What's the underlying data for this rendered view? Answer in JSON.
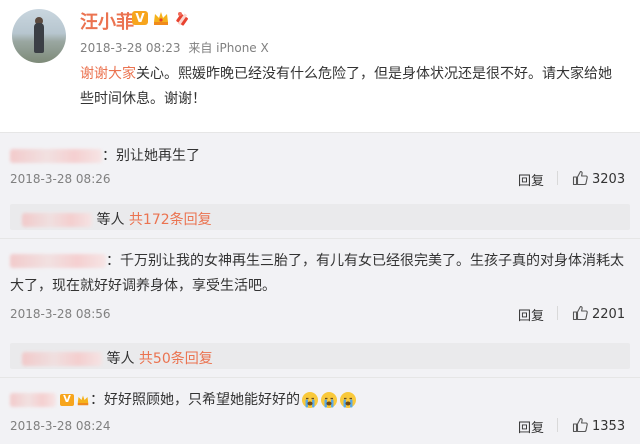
{
  "post": {
    "author": "汪小菲",
    "badge_letter": "V",
    "date": "2018-3-28 08:23",
    "source_prefix": "来自",
    "source": "iPhone X",
    "text_link": "谢谢大家",
    "text_body": "关心。熙媛昨晚已经没有什么危险了，但是身体状况还是很不好。请大家给她些时间休息。谢谢！"
  },
  "comments": [
    {
      "text": "别让她再生了",
      "time": "2018-3-28 08:26",
      "reply_label": "回复",
      "likes": "3203",
      "subreply": {
        "prefix": "等人",
        "count": "共172条回复"
      }
    },
    {
      "text": "千万别让我的女神再生三胎了，有儿有女已经很完美了。生孩子真的对身体消耗太大了，现在就好好调养身体，享受生活吧。",
      "line1": "千万别让我的女神再生三胎了，有儿有女已经很完美了。生孩子真的对身体消耗太",
      "line2": "大了，现在就好好调养身体，享受生活吧。",
      "time": "2018-3-28 08:56",
      "reply_label": "回复",
      "likes": "2201",
      "subreply": {
        "prefix": "等人",
        "count": "共50条回复"
      }
    },
    {
      "text": "好好照顾她，只希望她能好好的",
      "badge_letter": "V",
      "time": "2018-3-28 08:24",
      "reply_label": "回复",
      "likes": "1353"
    }
  ],
  "colors": {
    "accent": "#eb7350",
    "badge": "#f7a51d",
    "muted": "#808080",
    "panel": "#f2f2f5"
  },
  "icons": [
    "verified-v-icon",
    "crown-icon",
    "gift-icon",
    "thumbs-up-icon",
    "crying-emoji-icon"
  ]
}
